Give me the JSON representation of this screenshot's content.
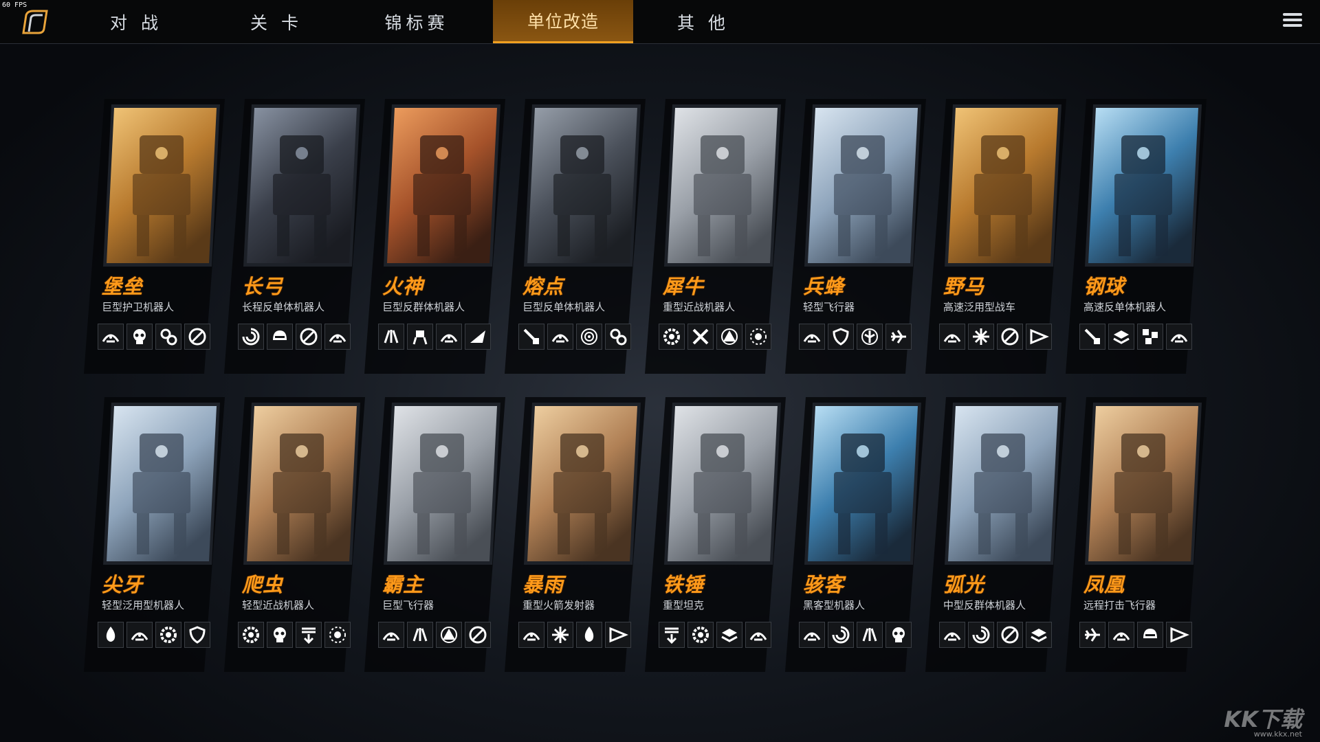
{
  "fps": "60 FPS",
  "tabs": [
    {
      "label": "对 战",
      "active": false
    },
    {
      "label": "关 卡",
      "active": false
    },
    {
      "label": "锦标赛",
      "active": false
    },
    {
      "label": "单位改造",
      "active": true
    },
    {
      "label": "其 他",
      "active": false
    }
  ],
  "colors": {
    "accent": "#ff9a1a",
    "tab_active": "#8a5612",
    "panel": "#050608"
  },
  "units": [
    {
      "name": "堡垒",
      "role": "巨型护卫机器人",
      "tone": "amber",
      "icons": [
        "shield-arc-icon",
        "skull-icon",
        "gears-icon",
        "no-entry-icon"
      ]
    },
    {
      "name": "长弓",
      "role": "长程反单体机器人",
      "tone": "red",
      "icons": [
        "swirl-icon",
        "helmet-icon",
        "no-entry-icon",
        "shield-arc-icon"
      ]
    },
    {
      "name": "火神",
      "role": "巨型反群体机器人",
      "tone": "orange",
      "icons": [
        "claw-icon",
        "mech-icon",
        "shield-arc-icon",
        "wave-icon"
      ]
    },
    {
      "name": "熔点",
      "role": "巨型反单体机器人",
      "tone": "steel",
      "icons": [
        "laser-icon",
        "shield-arc-icon",
        "target-icon",
        "gears-icon"
      ]
    },
    {
      "name": "犀牛",
      "role": "重型近战机器人",
      "tone": "fog",
      "icons": [
        "gear-icon",
        "tools-icon",
        "triangle-icon",
        "burst-icon"
      ]
    },
    {
      "name": "兵蜂",
      "role": "轻型飞行器",
      "tone": "ice",
      "icons": [
        "shield-arc-icon",
        "shield-icon",
        "tree-icon",
        "jet-icon"
      ]
    },
    {
      "name": "野马",
      "role": "高速泛用型战车",
      "tone": "amber",
      "icons": [
        "shield-arc-icon",
        "spark-icon",
        "no-entry-icon",
        "arrow-icon"
      ]
    },
    {
      "name": "钢球",
      "role": "高速反单体机器人",
      "tone": "blue",
      "icons": [
        "laser-icon",
        "layers-icon",
        "blocks-icon",
        "shield-arc-icon"
      ]
    },
    {
      "name": "尖牙",
      "role": "轻型泛用型机器人",
      "tone": "ice",
      "icons": [
        "flame-icon",
        "shield-arc-icon",
        "gear-icon",
        "shield-icon"
      ]
    },
    {
      "name": "爬虫",
      "role": "轻型近战机器人",
      "tone": "dust",
      "icons": [
        "gear-icon",
        "skull-icon",
        "drop-icon",
        "burst-icon"
      ]
    },
    {
      "name": "霸主",
      "role": "巨型飞行器",
      "tone": "fog",
      "icons": [
        "shield-arc-icon",
        "claw-icon",
        "triangle-icon",
        "no-entry-icon"
      ]
    },
    {
      "name": "暴雨",
      "role": "重型火箭发射器",
      "tone": "dust",
      "icons": [
        "shield-arc-icon",
        "spark-icon",
        "flame-icon",
        "arrow-icon"
      ]
    },
    {
      "name": "铁锤",
      "role": "重型坦克",
      "tone": "fog",
      "icons": [
        "drop-icon",
        "gear-icon",
        "layers-icon",
        "shield-arc-icon"
      ]
    },
    {
      "name": "骇客",
      "role": "黑客型机器人",
      "tone": "blue",
      "icons": [
        "shield-arc-icon",
        "swirl-icon",
        "claw-icon",
        "skull-icon"
      ]
    },
    {
      "name": "弧光",
      "role": "中型反群体机器人",
      "tone": "ice",
      "icons": [
        "shield-arc-icon",
        "swirl-icon",
        "no-entry-icon",
        "layers-icon"
      ]
    },
    {
      "name": "凤凰",
      "role": "远程打击飞行器",
      "tone": "dust",
      "icons": [
        "jet-icon",
        "shield-arc-icon",
        "helmet-icon",
        "arrow-icon"
      ]
    }
  ],
  "watermark": {
    "brand": "KK下载",
    "site": "www.kkx.net"
  }
}
